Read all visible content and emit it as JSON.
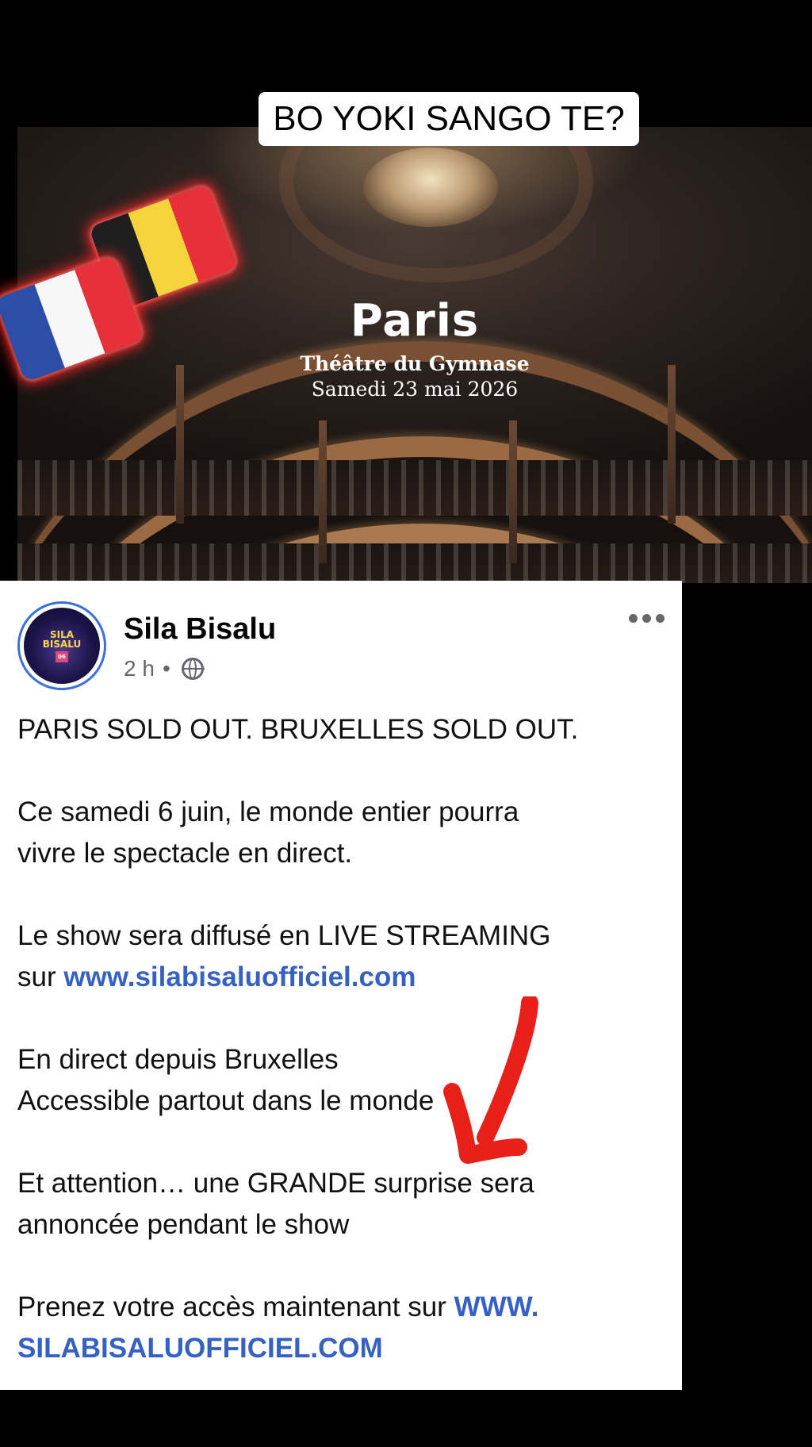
{
  "caption": "BO  YOKI SANGO TE?",
  "video": {
    "city": "Paris",
    "venue": "Théâtre du Gymnase",
    "date": "Samedi 23 mai 2026"
  },
  "flags": [
    {
      "name": "belgium-flag",
      "colors": [
        "#1f1f1f",
        "#f5d33a",
        "#e8303a"
      ]
    },
    {
      "name": "france-flag",
      "colors": [
        "#2b4fa8",
        "#f7f7f7",
        "#e8303a"
      ]
    }
  ],
  "avatar": {
    "line1": "SILA",
    "line2": "BISALU",
    "tag": "06"
  },
  "post": {
    "author": "Sila Bisalu",
    "time": "2 h",
    "separator": "•",
    "paragraphs": {
      "p1": "PARIS SOLD OUT. BRUXELLES SOLD OUT.",
      "p2_line1": "Ce samedi 6 juin, le monde entier pourra",
      "p2_line2": "vivre le spectacle en direct.",
      "p3_line1": "Le show sera diffusé en LIVE STREAMING",
      "p3_prefix": "sur ",
      "p3_link": "www.silabisaluofficiel.com",
      "p4_line1": "En direct depuis Bruxelles",
      "p4_line2": "Accessible partout dans le monde",
      "p5_line1": "Et attention… une GRANDE surprise sera",
      "p5_line2": "annoncée pendant le show",
      "p6_prefix": "Prenez votre accès maintenant sur ",
      "p6_link_a": "WWW.",
      "p6_link_b": "SILABISALUOFFICIEL.COM"
    }
  },
  "colors": {
    "link": "#3561c5",
    "arrow": "#e8201a",
    "avatar_ring": "#3b6fe0"
  }
}
